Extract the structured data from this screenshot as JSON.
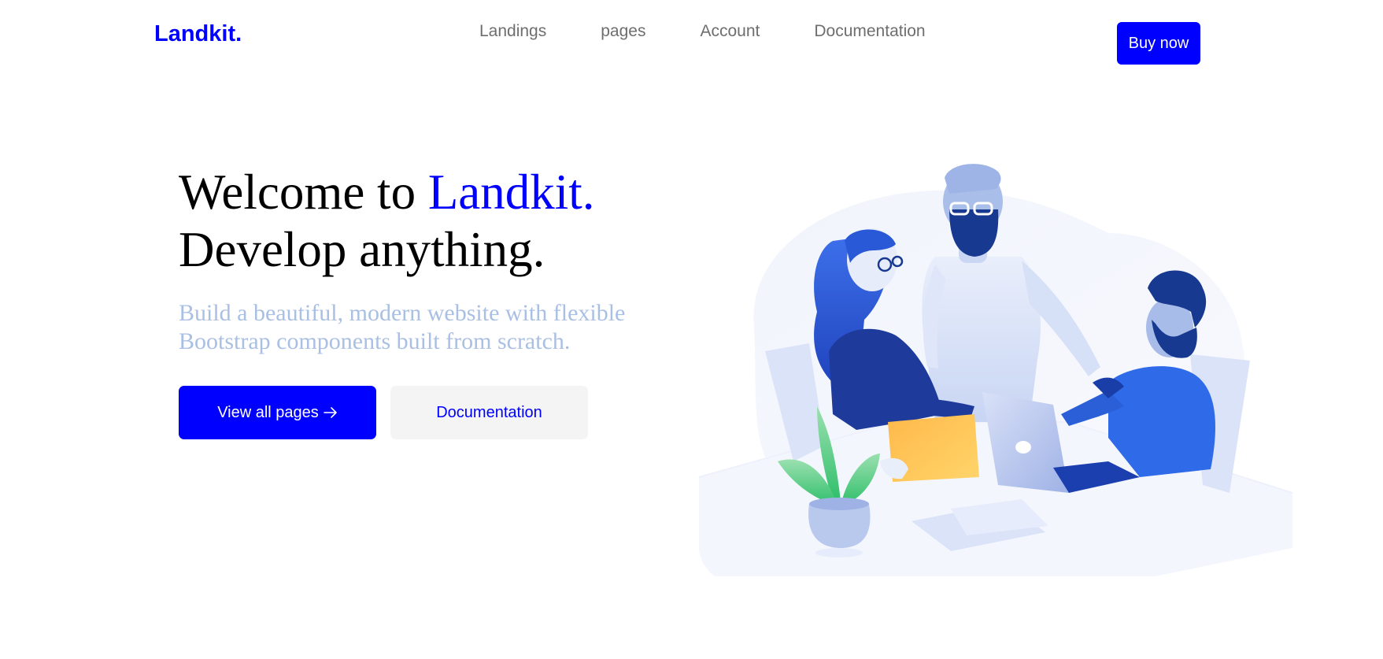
{
  "nav": {
    "brand": "Landkit.",
    "links": [
      "Landings",
      "pages",
      "Account",
      "Documentation"
    ],
    "cta": "Buy now"
  },
  "hero": {
    "title_prefix": "Welcome to ",
    "title_accent": "Landkit.",
    "title_line2": "Develop anything.",
    "lead": "Build a beautiful, modern website with flexible Bootstrap components built from scratch.",
    "primary_button": "View all pages",
    "primary_button_icon": "arrow-right-icon",
    "secondary_button": "Documentation"
  },
  "illustration": {
    "name": "team-working-illustration"
  },
  "colors": {
    "brand": "#0000ff",
    "lead_text": "#a9bfe3",
    "nav_text": "#6e6e6e",
    "secondary_button_bg": "#f4f4f4"
  }
}
